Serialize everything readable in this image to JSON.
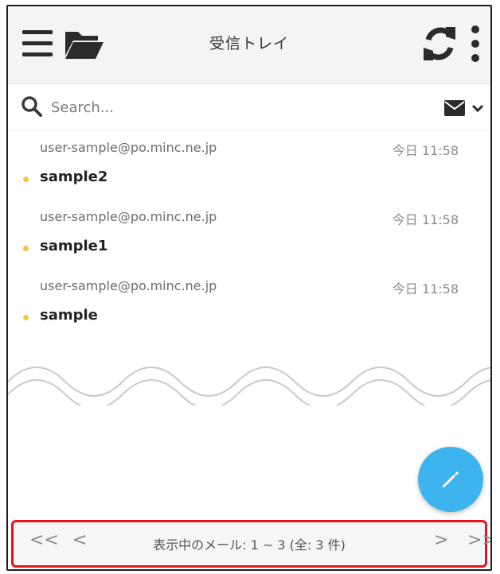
{
  "header": {
    "title": "受信トレイ",
    "menu_icon": "hamburger-icon",
    "folder_icon": "folder-open-icon",
    "refresh_icon": "refresh-icon",
    "more_icon": "kebab-menu-icon"
  },
  "search": {
    "placeholder": "Search...",
    "filter_icon": "envelope-icon",
    "dropdown_icon": "chevron-down-icon"
  },
  "messages": [
    {
      "from": "user-sample@po.minc.ne.jp",
      "time": "今日 11:58",
      "subject": "sample2",
      "unread": true
    },
    {
      "from": "user-sample@po.minc.ne.jp",
      "time": "今日 11:58",
      "subject": "sample1",
      "unread": true
    },
    {
      "from": "user-sample@po.minc.ne.jp",
      "time": "今日 11:58",
      "subject": "sample",
      "unread": true
    }
  ],
  "compose": {
    "icon": "pencil-icon"
  },
  "pagination": {
    "first": "<<",
    "prev": "<",
    "status": "表示中のメール: 1 ~ 3 (全: 3 件)",
    "next": ">",
    "last": ">>"
  },
  "colors": {
    "accent": "#3db4ee",
    "unread_dot": "#f5c542",
    "highlight_border": "#e8141c"
  }
}
